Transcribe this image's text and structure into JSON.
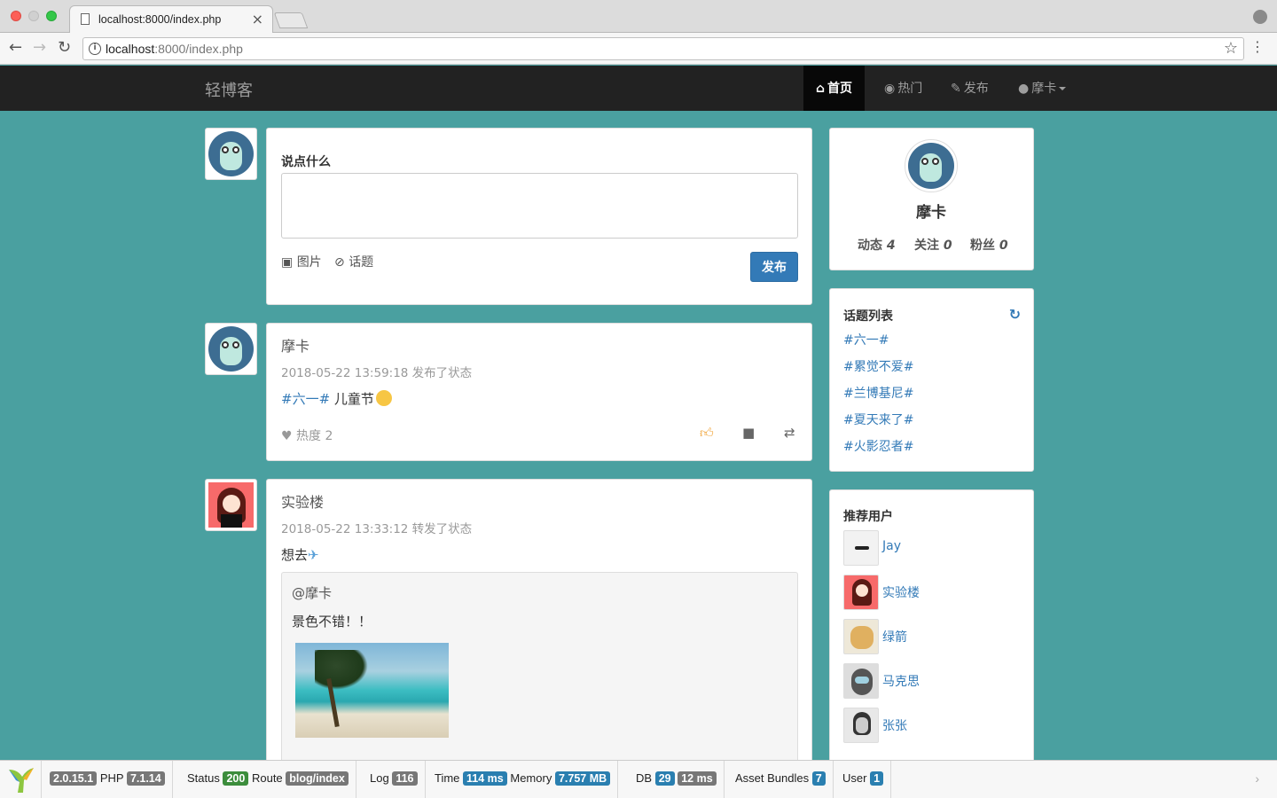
{
  "browser": {
    "tab_title": "localhost:8000/index.php",
    "tab_close": "×",
    "url_host": "localhost",
    "url_rest": ":8000/index.php"
  },
  "navbar": {
    "brand": "轻博客",
    "items": [
      {
        "label": "首页",
        "icon": "home-icon",
        "active": true
      },
      {
        "label": "热门",
        "icon": "globe-icon",
        "active": false
      },
      {
        "label": "发布",
        "icon": "edit-icon",
        "active": false
      },
      {
        "label": "摩卡",
        "icon": "user-icon",
        "active": false
      }
    ]
  },
  "composer": {
    "label": "说点什么",
    "image_label": "图片",
    "topic_label": "话题",
    "submit_label": "发布"
  },
  "posts": [
    {
      "author": "摩卡",
      "meta": "2018-05-22 13:59:18 发布了状态",
      "topic": "#六一#",
      "text": " 儿童节",
      "heat": "热度 2"
    },
    {
      "author": "实验楼",
      "meta": "2018-05-22 13:33:12 转发了状态",
      "text": "想去",
      "quote_author": "@摩卡",
      "quote_text": "景色不错！！"
    }
  ],
  "profile": {
    "name": "摩卡",
    "stats": [
      {
        "label": "动态",
        "value": "4"
      },
      {
        "label": "关注",
        "value": "0"
      },
      {
        "label": "粉丝",
        "value": "0"
      }
    ]
  },
  "topics": {
    "title": "话题列表",
    "items": [
      "#六一#",
      "#累觉不爱#",
      "#兰博基尼#",
      "#夏天来了#",
      "#火影忍者#"
    ]
  },
  "recommended": {
    "title": "推荐用户",
    "users": [
      "Jay",
      "实验楼",
      "绿箭",
      "马克思",
      "张张"
    ]
  },
  "debug": {
    "yii_version": "2.0.15.1",
    "php_label": "PHP",
    "php_version": "7.1.14",
    "status_label": "Status",
    "status": "200",
    "route_label": "Route",
    "route": "blog/index",
    "log_label": "Log",
    "log": "116",
    "time_label": "Time",
    "time": "114 ms",
    "memory_label": "Memory",
    "memory": "7.757 MB",
    "db_label": "DB",
    "db_count": "29",
    "db_time": "12 ms",
    "bundles_label": "Asset Bundles",
    "bundles": "7",
    "user_label": "User",
    "user": "1"
  }
}
